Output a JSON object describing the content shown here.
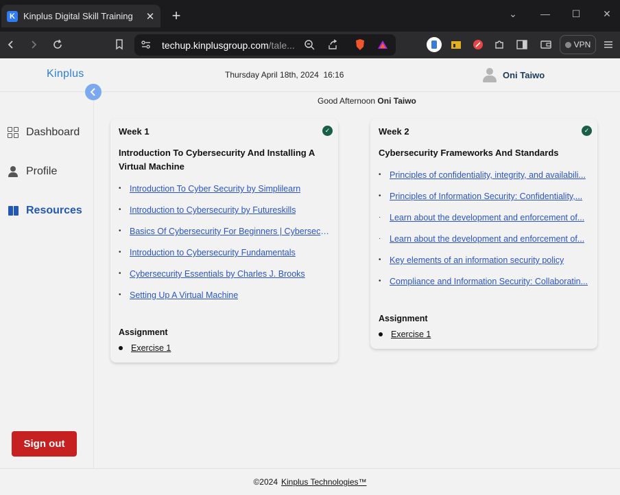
{
  "browser": {
    "tab_title": "Kinplus Digital Skill Training",
    "favicon_letter": "K",
    "url_host": "techup.kinplusgroup.com",
    "url_rest": "/tale...",
    "vpn_label": "VPN"
  },
  "header": {
    "logo": "Kinplus",
    "date": "Thursday  April 18th, 2024",
    "time": "16:16",
    "user_name": "Oni Taiwo"
  },
  "greeting": {
    "prefix": "Good Afternoon",
    "name": "Oni Taiwo"
  },
  "sidebar": {
    "items": [
      {
        "label": "Dashboard",
        "icon": "grid-icon"
      },
      {
        "label": "Profile",
        "icon": "person-icon"
      },
      {
        "label": "Resources",
        "icon": "book-icon"
      }
    ],
    "signout_label": "Sign out"
  },
  "weeks": [
    {
      "label": "Week 1",
      "title_line1": "Introduction To Cybersecurity And Installing A",
      "title_line2": "Virtual Machine",
      "resources": [
        "Introduction To Cyber Security by Simplilearn",
        "Introduction to Cybersecurity by Futureskills",
        "Basics Of Cybersecurity For Beginners | Cybersecuri...",
        "Introduction to Cybersecurity Fundamentals",
        "Cybersecurity Essentials by Charles J. Brooks",
        "Setting Up A Virtual Machine"
      ],
      "assignment_heading": "Assignment",
      "assignments": [
        "Exercise 1"
      ]
    },
    {
      "label": "Week 2",
      "title_line1": "Cybersecurity Frameworks And Standards",
      "title_line2": "",
      "resources": [
        "Principles of confidentiality, integrity, and availabili...",
        "Principles of Information Security: Confidentiality,...",
        "Learn about the development and enforcement of...",
        "Learn about the development and enforcement of...",
        "Key elements of an information security policy",
        "Compliance and Information Security: Collaboratin..."
      ],
      "assignment_heading": "Assignment",
      "assignments": [
        "Exercise 1"
      ]
    }
  ],
  "footer": {
    "copyright": "©2024",
    "company": "Kinplus Technologies™"
  },
  "colors": {
    "accent": "#2158b6",
    "link": "#2b55c7",
    "signout": "#c62020",
    "check": "#1b5e48"
  }
}
